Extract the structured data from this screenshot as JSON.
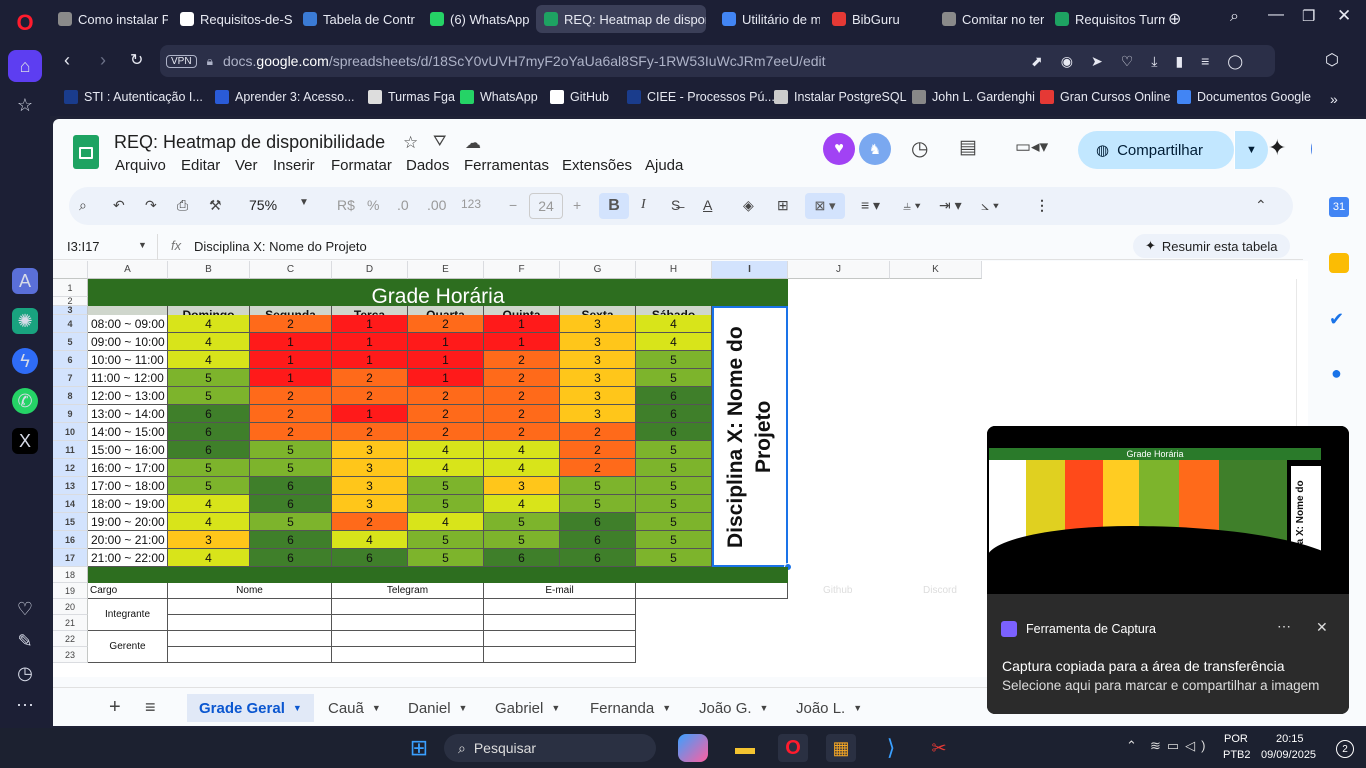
{
  "browser": {
    "tabs": [
      {
        "label": "Como instalar P",
        "color": "#8a8a8a"
      },
      {
        "label": "Requisitos-de-S",
        "color": "#ffffff"
      },
      {
        "label": "Tabela de Contr",
        "color": "#3b7bd5"
      },
      {
        "label": "(6) WhatsApp",
        "color": "#25d366"
      },
      {
        "label": "REQ: Heatmap de disponi",
        "color": "#1ea362"
      },
      {
        "label": "Utilitário de ma",
        "color": "#4285f4"
      },
      {
        "label": "BibGuru",
        "color": "#e53935"
      },
      {
        "label": "Comitar no terr",
        "color": "#8a8a8a"
      },
      {
        "label": "Requisitos Turm",
        "color": "#1ea362"
      }
    ],
    "url_prefix": "docs.",
    "url_domain": "google.com",
    "url_path": "/spreadsheets/d/18ScY0vUVH7myF2oYaUa6al8SFy-1RW53IuWcJRm7eeU/edit",
    "vpn_label": "VPN",
    "bookmarks": [
      {
        "label": "STI : Autenticação I...",
        "color": "#1a3c8c"
      },
      {
        "label": "Aprender 3: Acesso...",
        "color": "#2a5bd7"
      },
      {
        "label": "Turmas Fga",
        "color": "#dddddd"
      },
      {
        "label": "WhatsApp",
        "color": "#25d366"
      },
      {
        "label": "GitHub",
        "color": "#ffffff"
      },
      {
        "label": "CIEE - Processos Pú...",
        "color": "#1a3c8c"
      },
      {
        "label": "Instalar PostgreSQL",
        "color": "#cccccc"
      },
      {
        "label": "John L. Gardenghi",
        "color": "#888888"
      },
      {
        "label": "Gran Cursos Online",
        "color": "#e53935"
      },
      {
        "label": "Documentos Google",
        "color": "#4285f4"
      }
    ]
  },
  "sheets": {
    "title": "REQ: Heatmap de disponibilidade",
    "menus": [
      "Arquivo",
      "Editar",
      "Ver",
      "Inserir",
      "Formatar",
      "Dados",
      "Ferramentas",
      "Extensões",
      "Ajuda"
    ],
    "share_label": "Compartilhar",
    "zoom": "75%",
    "currency": "R$",
    "percent": "%",
    "dec_down": ".0",
    "dec_up": ".00",
    "num_format": "123",
    "font_size": "24",
    "bold_label": "B",
    "italic_label": "I",
    "cell_ref": "I3:I17",
    "formula": "Disciplina X: Nome do Projeto",
    "summarize_label": "Resumir esta tabela",
    "columns": [
      "A",
      "B",
      "C",
      "D",
      "E",
      "F",
      "G",
      "H",
      "I",
      "J",
      "K"
    ],
    "rows": [
      "1",
      "2",
      "3",
      "4",
      "5",
      "6",
      "7",
      "8",
      "9",
      "10",
      "11",
      "12",
      "13",
      "14",
      "15",
      "16",
      "17",
      "18",
      "19",
      "20",
      "21",
      "22",
      "23"
    ],
    "sheet_tabs": [
      "Grade Geral",
      "Cauã",
      "Daniel",
      "Gabriel",
      "Fernanda",
      "João G.",
      "João L."
    ]
  },
  "grid": {
    "title": "Grade Horária",
    "days": [
      "Domingo",
      "Segunda",
      "Terça",
      "Quarta",
      "Quinta",
      "Sexta",
      "Sábado"
    ],
    "times": [
      "08:00 ~ 09:00",
      "09:00 ~ 10:00",
      "10:00 ~ 11:00",
      "11:00 ~ 12:00",
      "12:00 ~ 13:00",
      "13:00 ~ 14:00",
      "14:00 ~ 15:00",
      "15:00 ~ 16:00",
      "16:00 ~ 17:00",
      "17:00 ~ 18:00",
      "18:00 ~ 19:00",
      "19:00 ~ 20:00",
      "20:00 ~ 21:00",
      "21:00 ~ 22:00"
    ],
    "values": [
      [
        4,
        2,
        1,
        2,
        1,
        3,
        4
      ],
      [
        4,
        1,
        1,
        1,
        1,
        3,
        4
      ],
      [
        4,
        1,
        1,
        1,
        2,
        3,
        5
      ],
      [
        5,
        1,
        2,
        1,
        2,
        3,
        5
      ],
      [
        5,
        2,
        2,
        2,
        2,
        3,
        6
      ],
      [
        6,
        2,
        1,
        2,
        2,
        3,
        6
      ],
      [
        6,
        2,
        2,
        2,
        2,
        2,
        6
      ],
      [
        6,
        5,
        3,
        4,
        4,
        2,
        5
      ],
      [
        5,
        5,
        3,
        4,
        4,
        2,
        5
      ],
      [
        5,
        6,
        3,
        5,
        3,
        5,
        5
      ],
      [
        4,
        6,
        3,
        5,
        4,
        5,
        5
      ],
      [
        4,
        5,
        2,
        4,
        5,
        6,
        5
      ],
      [
        3,
        6,
        4,
        5,
        5,
        6,
        5
      ],
      [
        4,
        6,
        6,
        5,
        6,
        6,
        5
      ]
    ],
    "colors": {
      "1": "#ff1a1a",
      "2": "#ff6a1a",
      "3": "#ffc61a",
      "4": "#d8e41a",
      "5": "#7db42c",
      "6": "#3f7f2a"
    },
    "project_label": "Disciplina X: Nome do Projeto",
    "team_headers": [
      "Cargo",
      "Nome",
      "Telegram",
      "E-mail"
    ],
    "roles": [
      "Integrante",
      "Gerente"
    ],
    "overflow_headers": [
      "Github",
      "Discord"
    ]
  },
  "notification": {
    "app": "Ferramenta de Captura",
    "title": "Captura copiada para a área de transferência",
    "body": "Selecione aqui para marcar e compartilhar a imagem",
    "preview_title": "Grade Horária",
    "preview_side": "Disciplina X: Nome do Projeto"
  },
  "taskbar": {
    "search": "Pesquisar",
    "lang": "POR",
    "layout": "PTB2",
    "time": "20:15",
    "date": "09/09/2025",
    "badge": "2"
  }
}
